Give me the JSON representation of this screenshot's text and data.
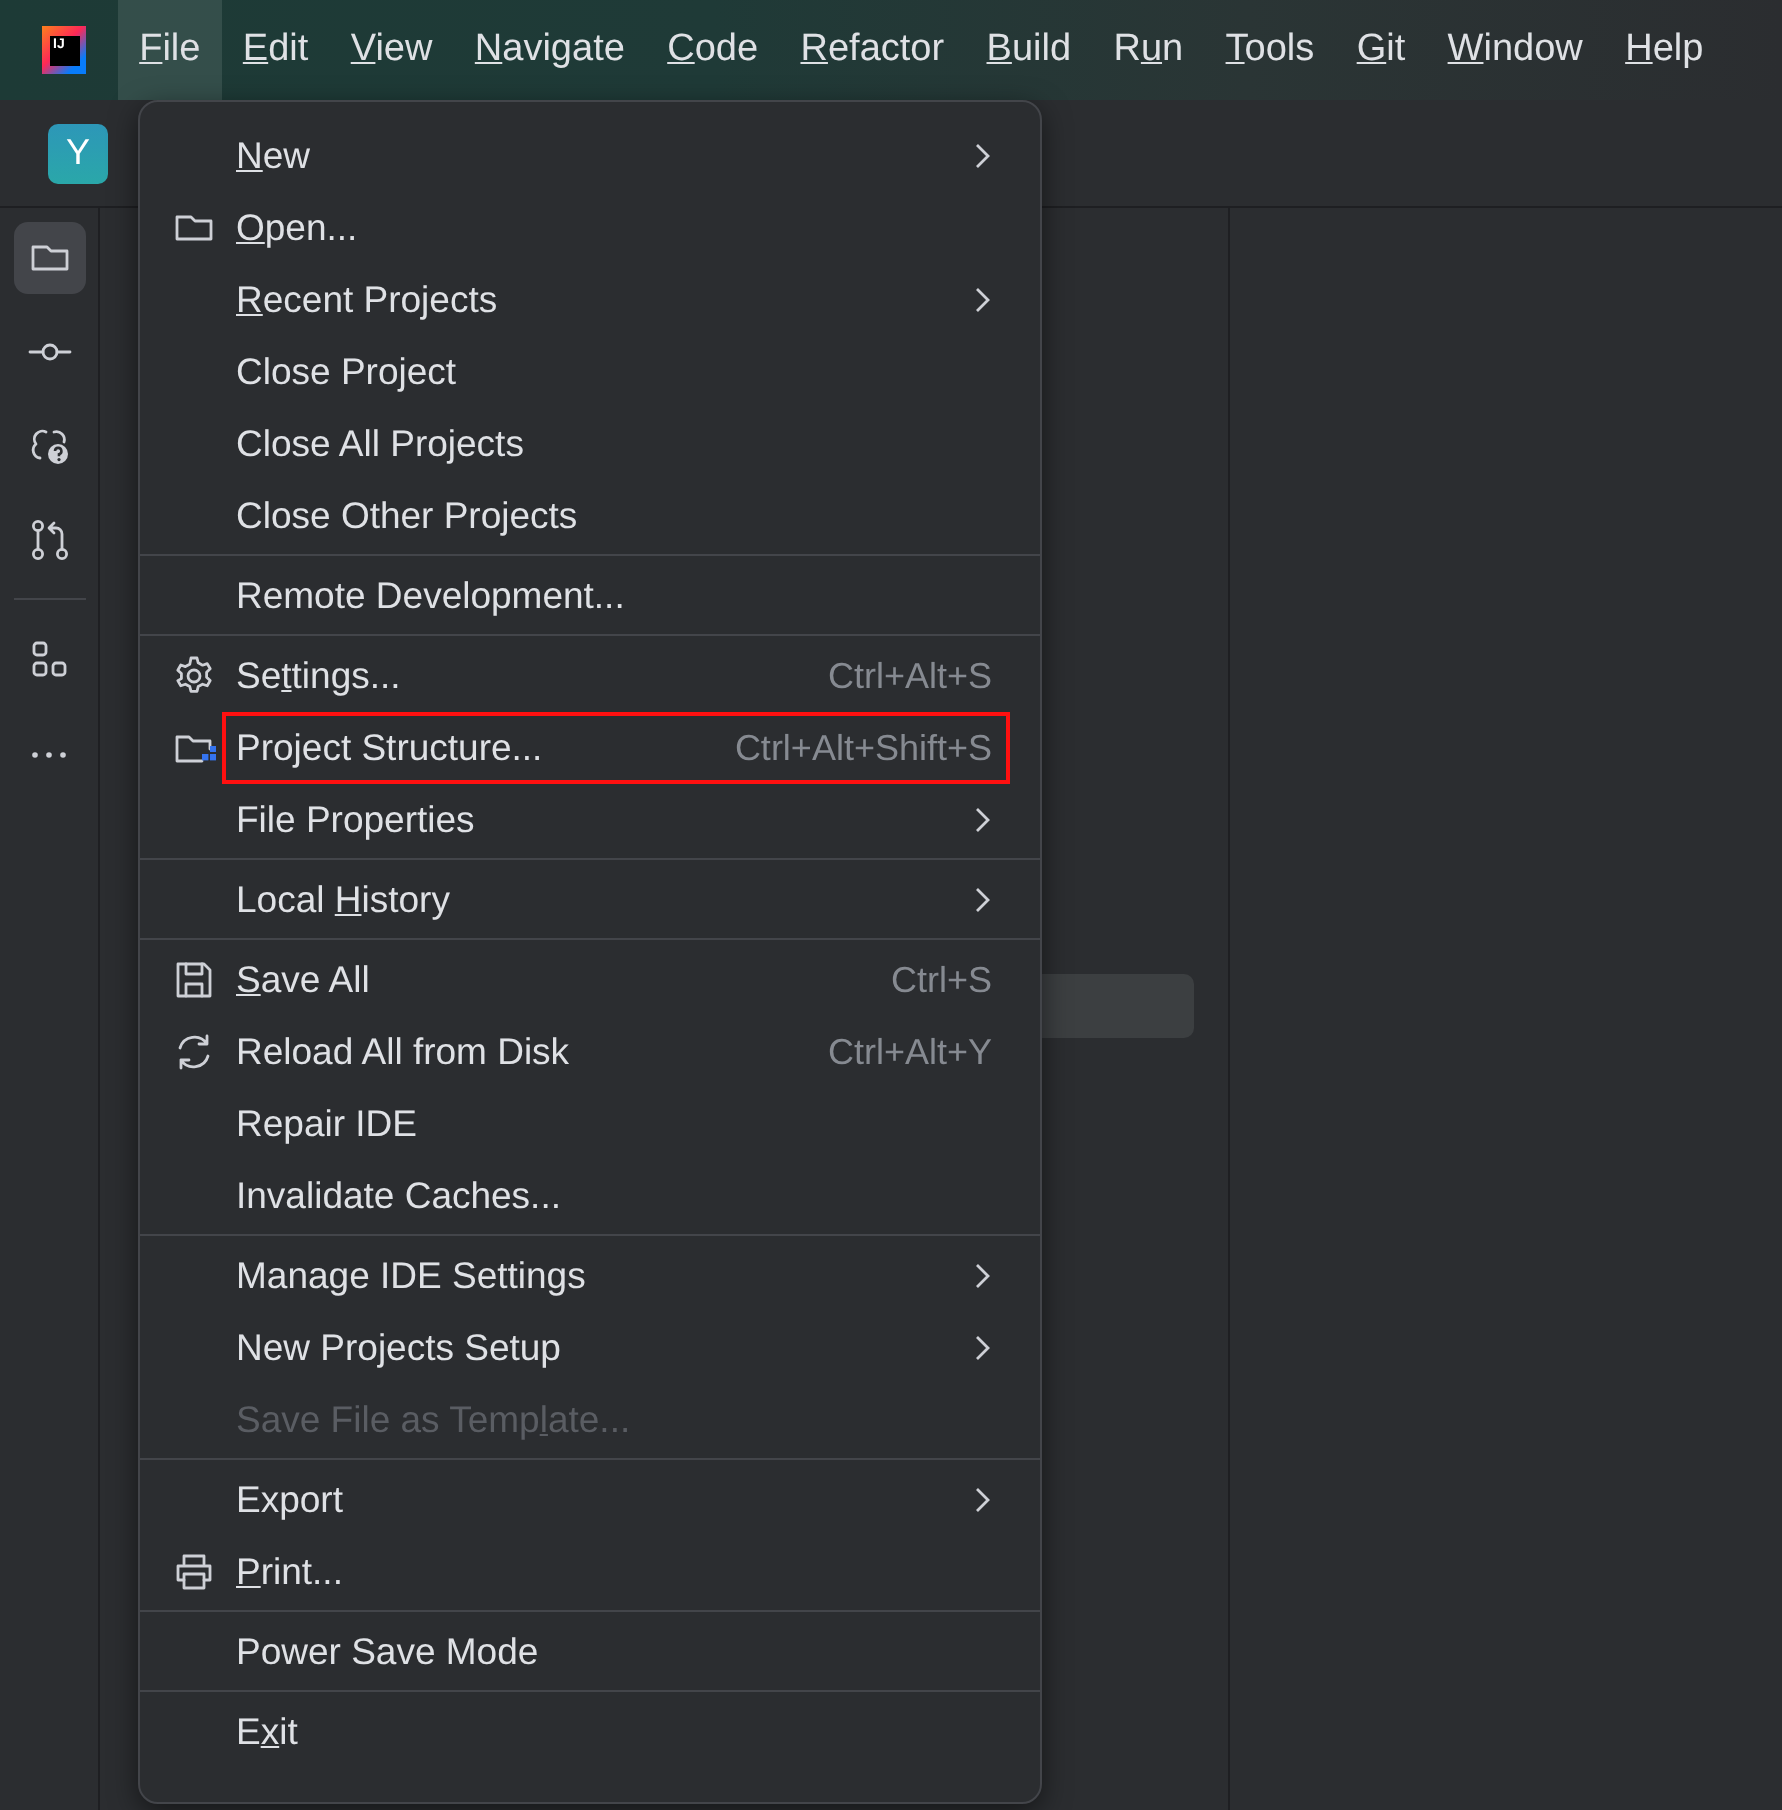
{
  "title_bar": {
    "logo": {
      "text": "IJ"
    },
    "menu": [
      {
        "key": "F",
        "after": "ile",
        "selected": true
      },
      {
        "key": "E",
        "after": "dit",
        "selected": false
      },
      {
        "key": "V",
        "after": "iew",
        "selected": false
      },
      {
        "key": "N",
        "after": "avigate",
        "selected": false
      },
      {
        "key": "C",
        "after": "ode",
        "selected": false
      },
      {
        "key": "R",
        "after": "efactor",
        "selected": false
      },
      {
        "key": "B",
        "after": "uild",
        "selected": false
      },
      {
        "before": "R",
        "key": "u",
        "after": "n",
        "selected": false
      },
      {
        "key": "T",
        "after": "ools",
        "selected": false
      },
      {
        "key": "G",
        "after": "it",
        "selected": false
      },
      {
        "key": "W",
        "after": "indow",
        "selected": false
      },
      {
        "key": "H",
        "after": "elp",
        "selected": false
      }
    ]
  },
  "project_tab": {
    "avatar": "Y"
  },
  "sidebar": {
    "groups": [
      [
        {
          "kind": "folder",
          "selected": true
        },
        {
          "kind": "commit",
          "selected": false
        },
        {
          "kind": "people",
          "selected": false
        },
        {
          "kind": "pull-request",
          "selected": false
        }
      ],
      [
        {
          "kind": "structure",
          "selected": false
        },
        {
          "kind": "more",
          "selected": false
        }
      ]
    ]
  },
  "file_menu": {
    "sections": [
      {
        "items": [
          {
            "key": "N",
            "after": "ew",
            "submenu": true,
            "disabled": false,
            "highlighted": false
          },
          {
            "kind": "folder",
            "key": "O",
            "after": "pen...",
            "submenu": false,
            "disabled": false,
            "highlighted": false
          },
          {
            "key": "R",
            "after": "ecent Projects",
            "submenu": true,
            "disabled": false,
            "highlighted": false
          },
          {
            "before": "Close Project",
            "submenu": false,
            "disabled": false,
            "highlighted": false
          },
          {
            "before": "Close All Projects",
            "submenu": false,
            "disabled": false,
            "highlighted": false
          },
          {
            "before": "Close Other Projects",
            "submenu": false,
            "disabled": false,
            "highlighted": false
          }
        ]
      },
      {
        "items": [
          {
            "before": "Remote Development...",
            "submenu": false,
            "disabled": false,
            "highlighted": false
          }
        ]
      },
      {
        "items": [
          {
            "kind": "gear",
            "before": "Se",
            "key": "t",
            "after": "tings...",
            "shortcut": "Ctrl+Alt+S",
            "submenu": false,
            "disabled": false,
            "highlighted": false
          },
          {
            "kind": "project-folder",
            "before": "Project Structure...",
            "shortcut": "Ctrl+Alt+Shift+S",
            "submenu": false,
            "disabled": false,
            "highlighted": true
          },
          {
            "before": "File Properties",
            "submenu": true,
            "disabled": false,
            "highlighted": false
          }
        ]
      },
      {
        "items": [
          {
            "before": "Local ",
            "key": "H",
            "after": "istory",
            "submenu": true,
            "disabled": false,
            "highlighted": false
          }
        ]
      },
      {
        "items": [
          {
            "kind": "save",
            "key": "S",
            "after": "ave All",
            "shortcut": "Ctrl+S",
            "submenu": false,
            "disabled": false,
            "highlighted": false
          },
          {
            "kind": "reload",
            "before": "Reload All from Disk",
            "shortcut": "Ctrl+Alt+Y",
            "submenu": false,
            "disabled": false,
            "highlighted": false
          },
          {
            "before": "Repair IDE",
            "submenu": false,
            "disabled": false,
            "highlighted": false
          },
          {
            "before": "Invalidate Caches...",
            "submenu": false,
            "disabled": false,
            "highlighted": false
          }
        ]
      },
      {
        "items": [
          {
            "before": "Manage IDE Settings",
            "submenu": true,
            "disabled": false,
            "highlighted": false
          },
          {
            "before": "New Projects Setup",
            "submenu": true,
            "disabled": false,
            "highlighted": false
          },
          {
            "before": "Save File as Temp",
            "key": "l",
            "after": "ate...",
            "submenu": false,
            "disabled": true,
            "highlighted": false
          }
        ]
      },
      {
        "items": [
          {
            "before": "Export",
            "submenu": true,
            "disabled": false,
            "highlighted": false
          },
          {
            "kind": "printer",
            "key": "P",
            "after": "rint...",
            "submenu": false,
            "disabled": false,
            "highlighted": false
          }
        ]
      },
      {
        "items": [
          {
            "before": "Power Save Mode",
            "submenu": false,
            "disabled": false,
            "highlighted": false
          }
        ]
      },
      {
        "items": [
          {
            "before": "E",
            "key": "x",
            "after": "it",
            "submenu": false,
            "disabled": false,
            "highlighted": false
          }
        ]
      }
    ]
  }
}
